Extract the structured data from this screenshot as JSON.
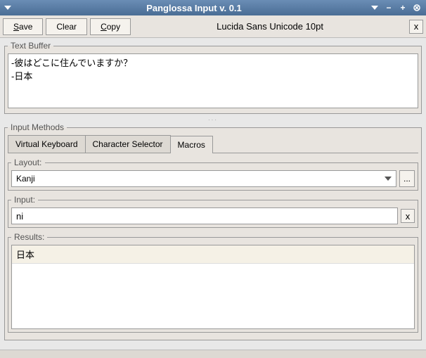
{
  "window": {
    "title": "Panglossa Input v. 0.1"
  },
  "toolbar": {
    "save": "Save",
    "clear": "Clear",
    "copy": "Copy",
    "font_label": "Lucida Sans Unicode 10pt",
    "close": "x"
  },
  "text_buffer": {
    "legend": "Text Buffer",
    "content": "-彼はどこに住んでいますか？\n-日本"
  },
  "input_methods": {
    "legend": "Input Methods",
    "tabs": {
      "virtual_keyboard": "Virtual Keyboard",
      "character_selector": "Character Selector",
      "macros": "Macros"
    },
    "layout": {
      "label": "Layout:",
      "value": "Kanji",
      "more": "..."
    },
    "input": {
      "legend": "Input:",
      "value": "ni",
      "clear": "x"
    },
    "results": {
      "legend": "Results:",
      "items": [
        "日本"
      ]
    }
  }
}
